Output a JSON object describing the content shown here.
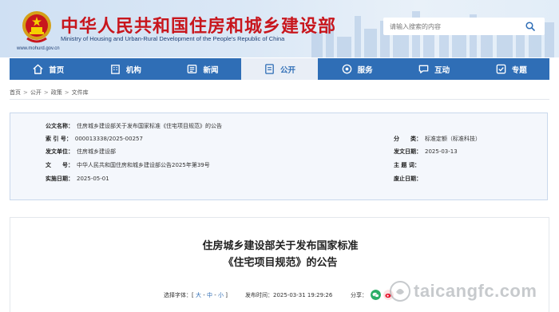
{
  "header": {
    "title": "中华人民共和国住房和城乡建设部",
    "subtitle": "Ministry of Housing and Urban-Rural Development of the People's Republic of China",
    "url": "www.mohurd.gov.cn",
    "search_placeholder": "请输入搜索的内容"
  },
  "nav": {
    "items": [
      {
        "label": "首页",
        "icon": "home-icon"
      },
      {
        "label": "机构",
        "icon": "building-icon"
      },
      {
        "label": "新闻",
        "icon": "news-icon"
      },
      {
        "label": "公开",
        "icon": "disclosure-icon",
        "active": true
      },
      {
        "label": "服务",
        "icon": "service-icon"
      },
      {
        "label": "互动",
        "icon": "chat-icon"
      },
      {
        "label": "专题",
        "icon": "topic-icon"
      }
    ]
  },
  "breadcrumb": [
    "首页",
    "公开",
    "政策",
    "文件库"
  ],
  "meta": {
    "doc_name_key": "公文名称：",
    "doc_name_val": "住房城乡建设部关于发布国家标准《住宅项目规范》的公告",
    "index_key": "索 引 号：",
    "index_val": "000013338/2025-00257",
    "category_key": "分　　类：",
    "category_val": "标准定额（标准科技）",
    "issuer_key": "发文单位：",
    "issuer_val": "住房城乡建设部",
    "issue_date_key": "发文日期：",
    "issue_date_val": "2025-03-13",
    "docno_key": "文　　号：",
    "docno_val": "中华人民共和国住房和城乡建设部公告2025年第39号",
    "subject_key": "主 题 词：",
    "subject_val": "",
    "effective_key": "实施日期：",
    "effective_val": "2025-05-01",
    "repeal_key": "废止日期：",
    "repeal_val": ""
  },
  "article": {
    "title_line1": "住房城乡建设部关于发布国家标准",
    "title_line2": "《住宅项目规范》的公告",
    "font_label": "选择字体：",
    "font_open": "[",
    "font_large": "大",
    "font_medium": "中",
    "font_small": "小",
    "font_close": "]",
    "publish_label": "发布时间：",
    "publish_time": "2025-03-31 19:29:26",
    "share_label": "分享："
  },
  "watermark": {
    "text": "taicangfc.com"
  },
  "colors": {
    "brand_red": "#c8161d",
    "nav_blue": "#2f6eb6",
    "wechat_green": "#2aae67",
    "weibo_red": "#e6162d"
  }
}
